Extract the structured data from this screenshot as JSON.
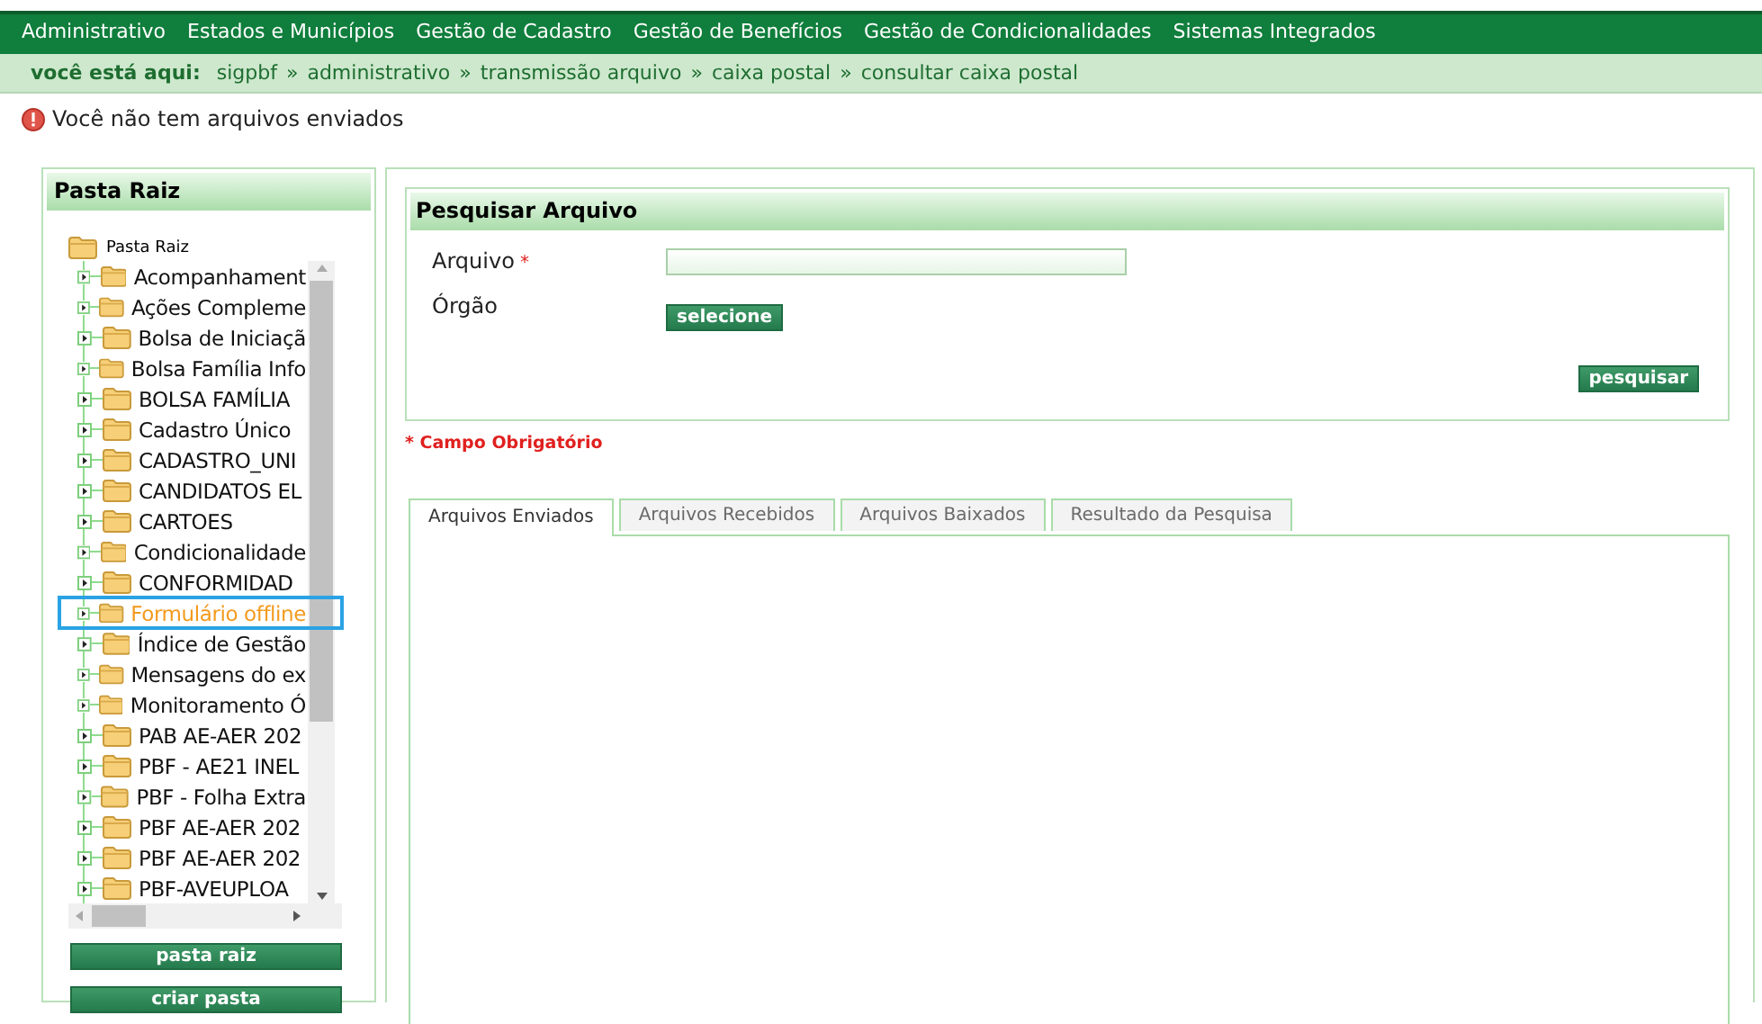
{
  "menu": [
    "Administrativo",
    "Estados e Municípios",
    "Gestão de Cadastro",
    "Gestão de Benefícios",
    "Gestão de Condicionalidades",
    "Sistemas Integrados"
  ],
  "breadcrumb": {
    "label": "você está aqui:",
    "items": [
      "sigpbf",
      "administrativo",
      "transmissão arquivo",
      "caixa postal",
      "consultar caixa postal"
    ],
    "separators": [
      "»",
      "»",
      "»",
      "»"
    ]
  },
  "message": {
    "kind": "error",
    "text": "Você não tem arquivos enviados"
  },
  "folder_panel": {
    "title": "Pasta Raiz",
    "root": {
      "label": "Pasta Raiz",
      "expanded": true,
      "children": [
        {
          "label": "Acompanhament",
          "expanded": false,
          "selected": false
        },
        {
          "label": "Ações Compleme",
          "expanded": false,
          "selected": false
        },
        {
          "label": "Bolsa de Iniciaçã",
          "expanded": false,
          "selected": false
        },
        {
          "label": "Bolsa Família Info",
          "expanded": false,
          "selected": false
        },
        {
          "label": "BOLSA FAMÍLIA",
          "expanded": false,
          "selected": false
        },
        {
          "label": "Cadastro Único",
          "expanded": false,
          "selected": false
        },
        {
          "label": "CADASTRO_UNI",
          "expanded": false,
          "selected": false
        },
        {
          "label": "CANDIDATOS EL",
          "expanded": false,
          "selected": false
        },
        {
          "label": "CARTOES",
          "expanded": false,
          "selected": false
        },
        {
          "label": "Condicionalidade",
          "expanded": false,
          "selected": false
        },
        {
          "label": "CONFORMIDAD",
          "expanded": false,
          "selected": false
        },
        {
          "label": "Formulário offline",
          "expanded": false,
          "selected": true
        },
        {
          "label": "Índice de Gestão",
          "expanded": false,
          "selected": false
        },
        {
          "label": "Mensagens do ex",
          "expanded": false,
          "selected": false
        },
        {
          "label": "Monitoramento Ó",
          "expanded": false,
          "selected": false
        },
        {
          "label": "PAB AE-AER 202",
          "expanded": false,
          "selected": false
        },
        {
          "label": "PBF - AE21 INEL",
          "expanded": false,
          "selected": false
        },
        {
          "label": "PBF - Folha Extra",
          "expanded": false,
          "selected": false
        },
        {
          "label": "PBF AE-AER 202",
          "expanded": false,
          "selected": false
        },
        {
          "label": "PBF AE-AER 202",
          "expanded": false,
          "selected": false
        },
        {
          "label": "PBF-AVEUPLOA",
          "expanded": false,
          "selected": false
        }
      ]
    },
    "buttons": [
      "pasta raiz",
      "criar pasta"
    ]
  },
  "search": {
    "title": "Pesquisar Arquivo",
    "fields": [
      {
        "kind": "text",
        "label": "Arquivo",
        "required_mark": "*"
      },
      {
        "kind": "picker",
        "label": "Órgão",
        "button": "selecione"
      }
    ],
    "submit": "pesquisar",
    "required_note": "* Campo Obrigatório"
  },
  "tabs": [
    {
      "label": "Arquivos Enviados",
      "selected": true
    },
    {
      "label": "Arquivos Recebidos",
      "selected": false
    },
    {
      "label": "Arquivos Baixados",
      "selected": false
    },
    {
      "label": "Resultado da Pesquisa",
      "selected": false
    }
  ]
}
